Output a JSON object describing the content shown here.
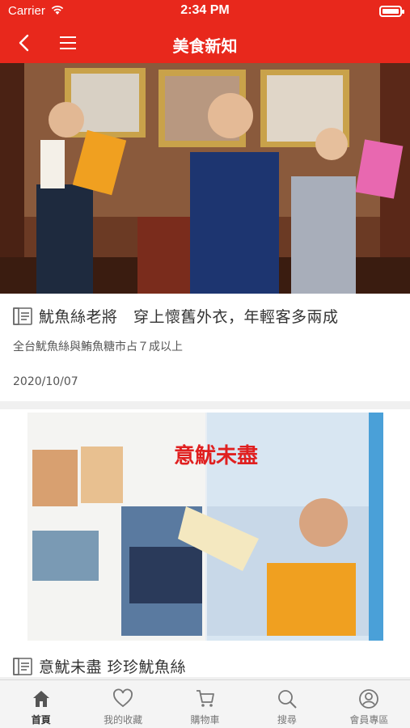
{
  "status_bar": {
    "carrier": "Carrier",
    "time": "2:34 PM"
  },
  "nav": {
    "title": "美食新知"
  },
  "articles": [
    {
      "title": "魷魚絲老將　穿上懷舊外衣，年輕客多兩成",
      "subtitle": "全台魷魚絲與鮪魚糖市占７成以上",
      "date": "2020/10/07"
    },
    {
      "title": "意魷未盡 珍珍魷魚絲",
      "image_headline": "意魷未盡"
    }
  ],
  "tabs": [
    {
      "label": "首頁",
      "icon": "home-icon",
      "active": true
    },
    {
      "label": "我的收藏",
      "icon": "heart-icon",
      "active": false
    },
    {
      "label": "購物車",
      "icon": "cart-icon",
      "active": false
    },
    {
      "label": "搜尋",
      "icon": "search-icon",
      "active": false
    },
    {
      "label": "會員專區",
      "icon": "user-icon",
      "active": false
    }
  ],
  "colors": {
    "brand_red": "#e8281c",
    "tab_bg": "#f4f4f4"
  }
}
